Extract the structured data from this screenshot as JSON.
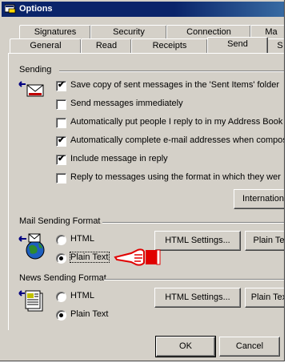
{
  "window": {
    "title": "Options"
  },
  "tabs_back": [
    "Signatures",
    "Security",
    "Connection",
    "Ma"
  ],
  "tabs_front": [
    "General",
    "Read",
    "Receipts",
    "Send",
    "S"
  ],
  "sending": {
    "heading": "Sending",
    "options": [
      {
        "label": "Save copy of sent messages in the 'Sent Items' folder",
        "checked": true
      },
      {
        "label": "Send messages immediately",
        "checked": false
      },
      {
        "label": "Automatically put people I reply to in my Address Book",
        "checked": false
      },
      {
        "label": "Automatically complete e-mail addresses when composin",
        "checked": true
      },
      {
        "label": "Include message in reply",
        "checked": true
      },
      {
        "label": "Reply to messages using the format in which they wer",
        "checked": false
      }
    ],
    "international_button": "Internation"
  },
  "mail_format": {
    "heading": "Mail Sending Format",
    "html_label": "HTML",
    "plain_label": "Plain Text",
    "selected": "plain",
    "html_settings_button": "HTML Settings...",
    "plain_settings_button": "Plain Te"
  },
  "news_format": {
    "heading": "News Sending Format",
    "html_label": "HTML",
    "plain_label": "Plain Text",
    "selected": "plain",
    "html_settings_button": "HTML Settings...",
    "plain_settings_button": "Plain Tex"
  },
  "footer": {
    "ok_button": "OK",
    "cancel_button": "Cancel"
  },
  "colors": {
    "face": "#d4d0c8",
    "titlebar": "#0a246a",
    "pointer": "#e00000"
  },
  "icons": [
    "options-window-icon",
    "send-envelope-icon",
    "globe-mail-icon",
    "news-doc-icon",
    "pointing-hand-icon"
  ]
}
